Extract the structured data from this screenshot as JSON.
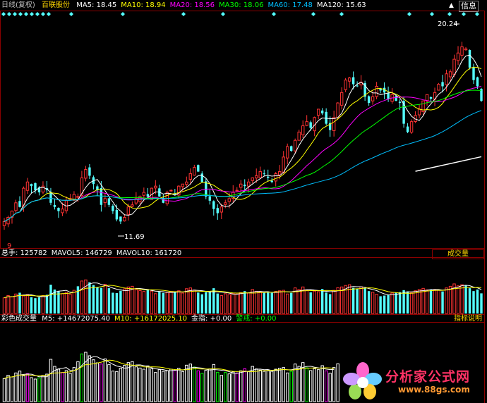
{
  "chart_data": [
    {
      "type": "candlestick",
      "title": "日线(复权)",
      "stock_name": "百联股份",
      "ma_labels": [
        {
          "name": "MA5",
          "value": "18.45",
          "color": "#ffffff"
        },
        {
          "name": "MA10",
          "value": "18.94",
          "color": "#ffff00"
        },
        {
          "name": "MA20",
          "value": "18.56",
          "color": "#ff00ff"
        },
        {
          "name": "MA30",
          "value": "18.06",
          "color": "#00ff00"
        },
        {
          "name": "MA60",
          "value": "17.48",
          "color": "#00bfff"
        },
        {
          "name": "MA120",
          "value": "15.63",
          "color": "#ffffff"
        }
      ],
      "annotations": [
        {
          "text": "20.24",
          "note": "high"
        },
        {
          "text": "11.69",
          "note": "low"
        },
        {
          "text": "9",
          "note": "marker"
        }
      ],
      "ylim": [
        10.9,
        21.4
      ],
      "close": [
        11.7,
        11.9,
        12.2,
        12.6,
        12.4,
        13.3,
        13.6,
        13.4,
        13.2,
        13.1,
        13.4,
        13.2,
        12.6,
        12.4,
        12.2,
        12.3,
        12.7,
        12.8,
        13.0,
        12.9,
        13.8,
        14.2,
        13.9,
        13.5,
        13.2,
        12.5,
        12.8,
        12.5,
        12.2,
        11.8,
        11.7,
        11.9,
        12.4,
        12.5,
        12.8,
        12.9,
        13.1,
        12.9,
        13.3,
        13.4,
        12.9,
        12.6,
        13.1,
        13.2,
        13.0,
        13.4,
        13.5,
        13.6,
        14.0,
        14.3,
        14.1,
        13.6,
        12.9,
        12.7,
        12.3,
        12.1,
        12.4,
        12.6,
        12.8,
        13.1,
        13.2,
        13.5,
        13.4,
        13.6,
        13.8,
        13.9,
        14.1,
        14.0,
        13.8,
        13.6,
        14.0,
        14.1,
        14.8,
        15.3,
        15.1,
        15.6,
        16.0,
        16.3,
        16.5,
        16.2,
        16.7,
        17.1,
        16.9,
        16.4,
        16.1,
        16.7,
        17.4,
        17.9,
        18.5,
        18.6,
        18.3,
        18.2,
        18.4,
        17.7,
        17.4,
        17.7,
        18.2,
        18.0,
        17.9,
        17.6,
        17.8,
        17.5,
        17.4,
        16.4,
        16.0,
        16.5,
        16.8,
        17.1,
        17.5,
        17.8,
        17.6,
        17.9,
        18.3,
        18.2,
        18.8,
        18.9,
        19.5,
        19.8,
        20.1,
        20.0,
        19.1,
        18.5,
        18.2,
        17.5
      ]
    },
    {
      "type": "bar",
      "title": "成交量",
      "labels": [
        {
          "name": "总手",
          "value": "125782",
          "color": "#ffffff"
        },
        {
          "name": "MAVOL5",
          "value": "146729",
          "color": "#ffffff"
        },
        {
          "name": "MAVOL10",
          "value": "161720",
          "color": "#ffffff"
        }
      ],
      "ylim": [
        0,
        330000
      ],
      "values": [
        98000,
        112000,
        105000,
        122000,
        130000,
        110000,
        119000,
        102000,
        96000,
        101000,
        112000,
        117000,
        180000,
        150000,
        138000,
        124000,
        132000,
        120000,
        145000,
        170000,
        203000,
        210000,
        195000,
        178000,
        165000,
        160000,
        182000,
        158000,
        130000,
        128000,
        142000,
        154000,
        166000,
        170000,
        148000,
        143000,
        138000,
        152000,
        140000,
        124000,
        136000,
        129000,
        131000,
        138000,
        133000,
        142000,
        128000,
        155000,
        160000,
        147000,
        131000,
        120000,
        134000,
        139000,
        158000,
        125000,
        112000,
        124000,
        118000,
        126000,
        122000,
        131000,
        140000,
        128000,
        150000,
        139000,
        134000,
        129000,
        131000,
        129000,
        138000,
        142000,
        145000,
        122000,
        129000,
        160000,
        150000,
        166000,
        144000,
        132000,
        140000,
        136000,
        153000,
        131000,
        121000,
        145000,
        161000,
        166000,
        175000,
        180000,
        160000,
        154000,
        167000,
        157000,
        140000,
        133000,
        120000,
        108000,
        112000,
        115000,
        128000,
        131000,
        134000,
        146000,
        138000,
        129000,
        142000,
        150000,
        157000,
        148000,
        150000,
        148000,
        146000,
        138000,
        160000,
        170000,
        185000,
        173000,
        180000,
        174000,
        158000,
        140000,
        150000,
        126000
      ]
    },
    {
      "type": "bar",
      "title": "彩色成交量",
      "labels": [
        {
          "name": "M5",
          "value": "+14672075.40",
          "color": "#ffffff"
        },
        {
          "name": "M10",
          "value": "+16172025.10",
          "color": "#ffff00"
        },
        {
          "name": "金指",
          "value": "+0.00",
          "color": "#ffffff"
        },
        {
          "name": "警戒",
          "value": "+0.00",
          "color": "#00ff00"
        }
      ]
    }
  ],
  "buttons": {
    "volume_indicator": "成交量",
    "indicator_help": "指标说明",
    "info_panel": "信息",
    "up_arrow": "▲",
    "down_arrow": "▼"
  },
  "logo": {
    "text": "分析家公式网",
    "url": "www.88gs.com"
  },
  "colors": {
    "up": "#ff3333",
    "down": "#54ffff",
    "panel_border": "#8b0000",
    "background": "#000000",
    "diamond": "#54ffff"
  }
}
